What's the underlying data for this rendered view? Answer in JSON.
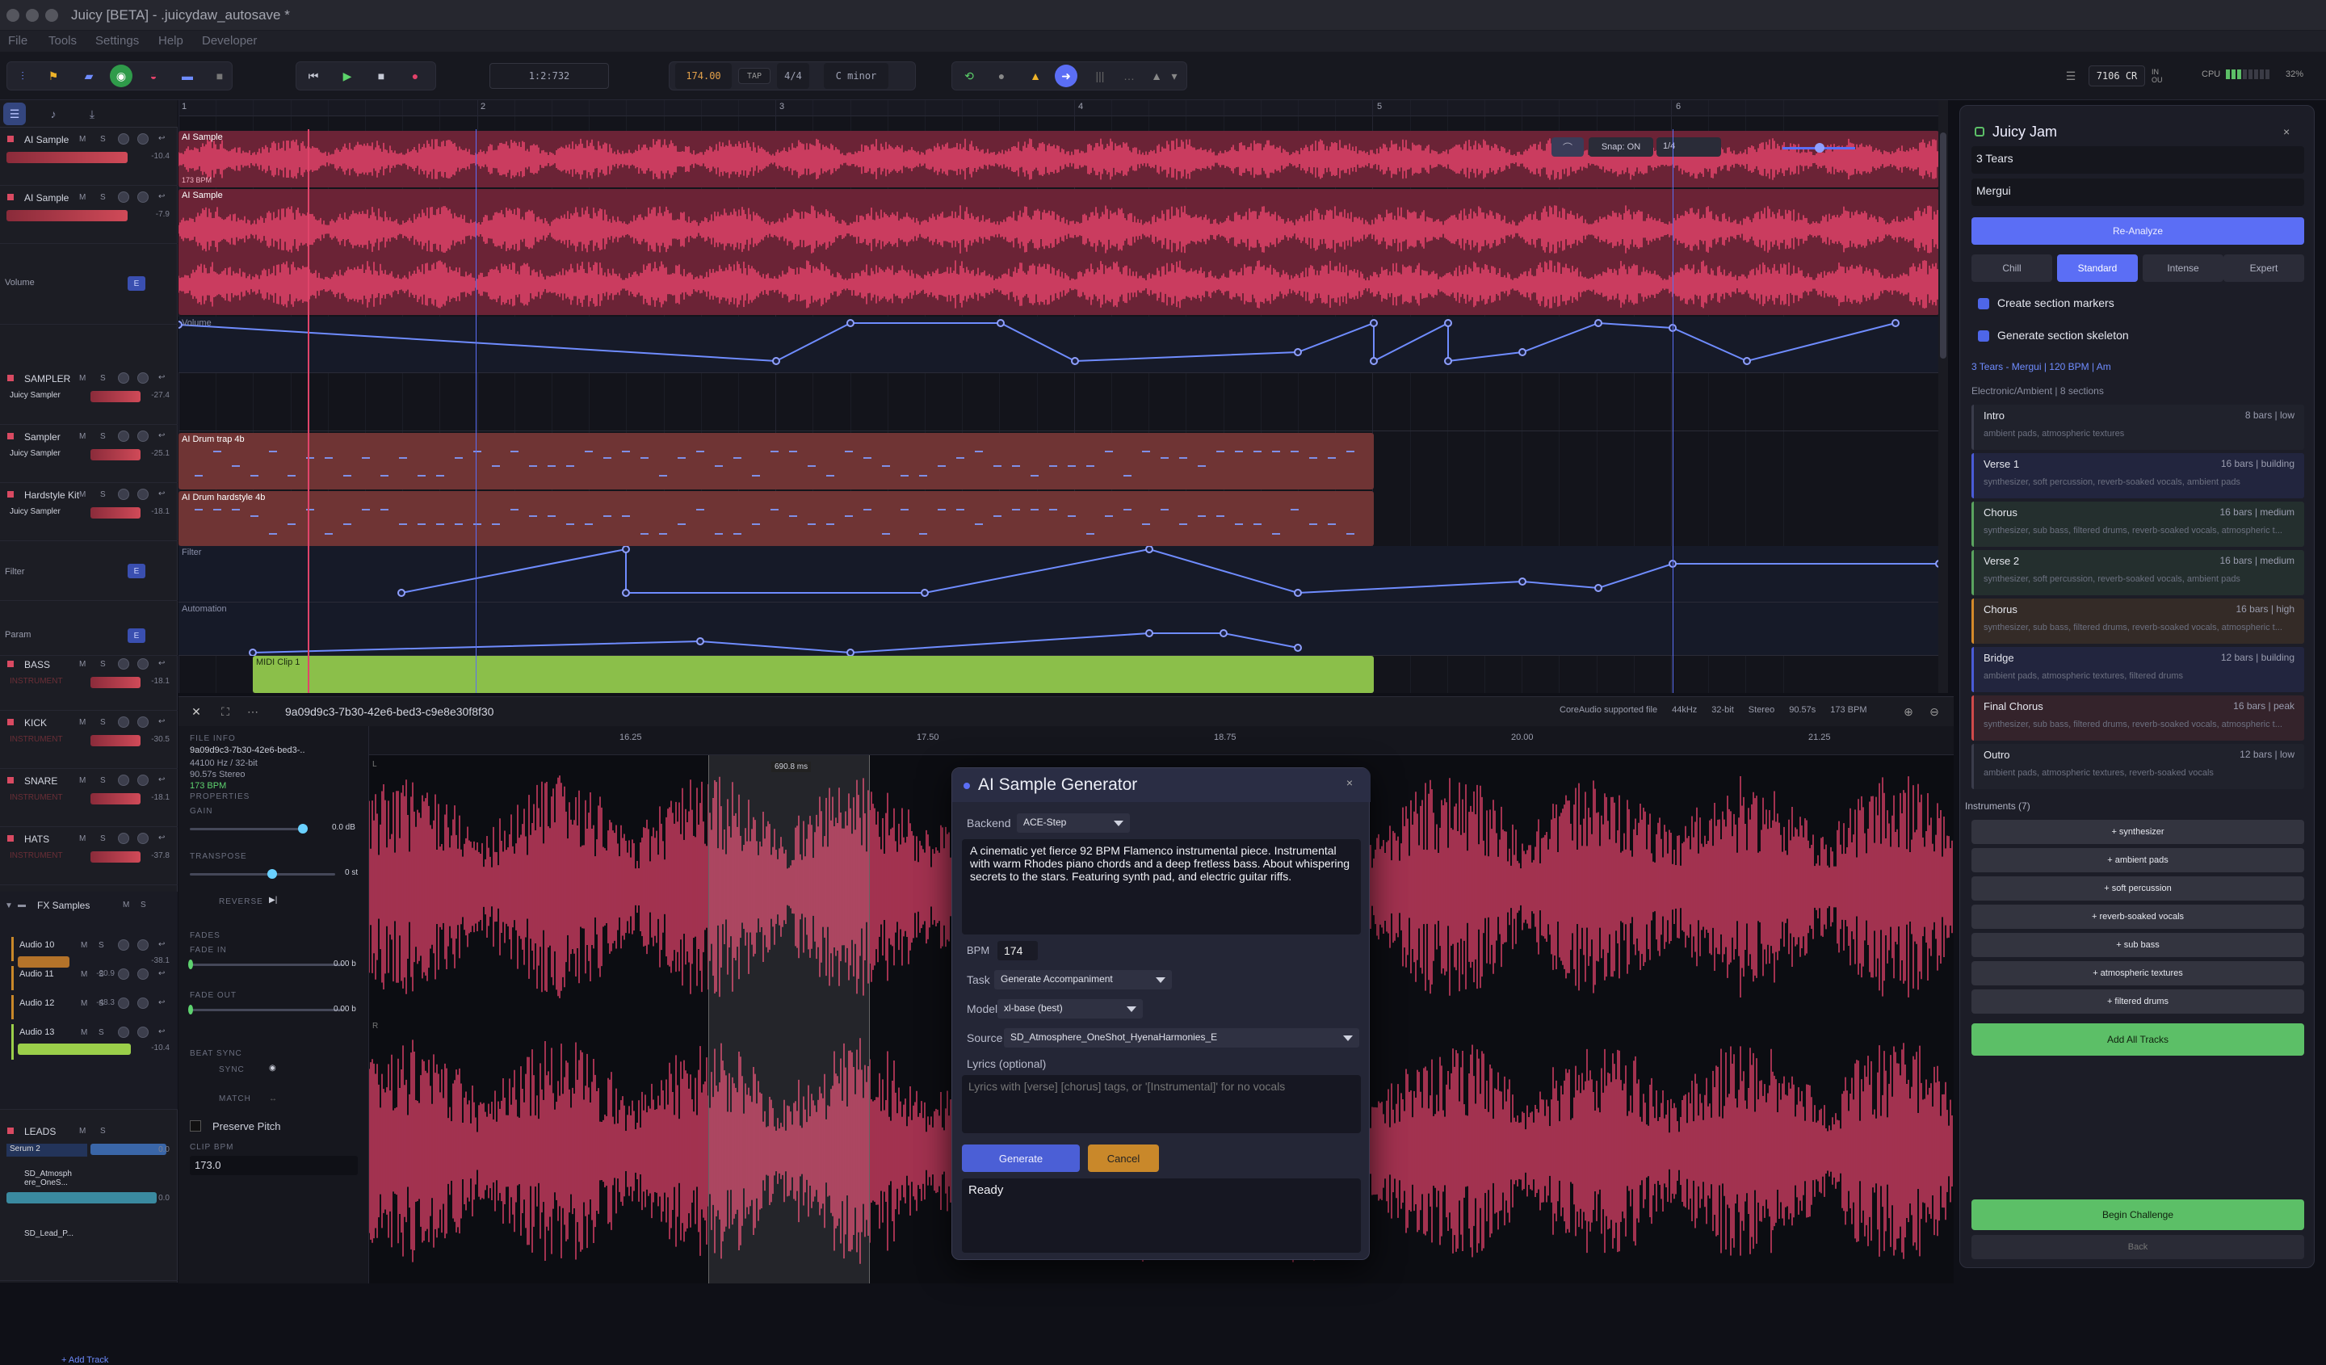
{
  "window": {
    "title": "Juicy [BETA] - .juicydaw_autosave *"
  },
  "menu": [
    "File",
    "Tools",
    "Settings",
    "Help",
    "Developer"
  ],
  "transport": {
    "position": "1:2:732",
    "bpm": "174.00",
    "tap": "TAP",
    "time_sig": "4/4",
    "key": "C minor",
    "credits": "7106 CR",
    "in_label": "IN",
    "ou_label": "OU",
    "cpu_label": "CPU",
    "cpu_percent": "32%"
  },
  "snap": {
    "label": "Snap: ON",
    "grid": "1/4"
  },
  "bars": [
    "1",
    "2",
    "3",
    "4",
    "5",
    "6"
  ],
  "tracks": [
    {
      "name": "AI Sample",
      "db": "-10.4"
    },
    {
      "name": "AI Sample",
      "db": "-7.9"
    },
    {
      "name": "Volume",
      "type": "auto",
      "btn": "E"
    },
    {
      "name": "SAMPLER",
      "sub": "Juicy Sampler",
      "db": "-27.4"
    },
    {
      "name": "Sampler",
      "sub": "Juicy Sampler",
      "db": "-25.1"
    },
    {
      "name": "Hardstyle Kit",
      "sub": "Juicy Sampler",
      "db": "-18.1"
    },
    {
      "name": "Filter",
      "type": "auto",
      "btn": "E"
    },
    {
      "name": "Param",
      "type": "auto",
      "btn": "E"
    },
    {
      "name": "BASS",
      "sub": "INSTRUMENT",
      "db": "-18.1"
    },
    {
      "name": "KICK",
      "sub": "INSTRUMENT",
      "db": "-30.5"
    },
    {
      "name": "SNARE",
      "sub": "INSTRUMENT",
      "db": "-18.1"
    },
    {
      "name": "HATS",
      "sub": "INSTRUMENT",
      "db": "-37.8"
    }
  ],
  "fx_group": {
    "name": "FX Samples",
    "children": [
      {
        "name": "Audio 10",
        "db": "-38.1"
      },
      {
        "name": "Audio 11",
        "db": "-20.9"
      },
      {
        "name": "Audio 12",
        "db": "-48.3"
      },
      {
        "name": "Audio 13",
        "db": "-10.4"
      }
    ]
  },
  "leads": {
    "name": "LEADS",
    "children": [
      {
        "name": "Serum 2",
        "db": "0.0"
      },
      {
        "name": "SD_Atmosph ere_OneS...",
        "db": "0.0"
      },
      {
        "name": "SD_Lead_P..."
      }
    ]
  },
  "add_track": "+ Add Track",
  "clips": {
    "ai1": "AI Sample",
    "ai1_bpm": "173 BPM",
    "ai2": "AI Sample",
    "volume": "Volume",
    "drum_trap": "AI Drum trap 4b",
    "drum_hard": "AI Drum hardstyle 4b",
    "filter": "Filter",
    "automation": "Automation",
    "midi": "MIDI Clip 1"
  },
  "editor": {
    "clip_id": "9a09d9c3-7b30-42e6-bed3-c9e8e30f8f30",
    "info_badges": [
      "CoreAudio supported file",
      "44kHz",
      "32-bit",
      "Stereo",
      "90.57s",
      "173 BPM"
    ],
    "ruler": [
      "16.25",
      "17.50",
      "18.75",
      "20.00",
      "21.25"
    ],
    "selection_len": "690.8 ms",
    "channel_l": "L",
    "channel_r": "R",
    "file_info_label": "FILE INFO",
    "file_name": "9a09d9c3-7b30-42e6-bed3-..",
    "file_rate": "44100 Hz / 32-bit",
    "file_len": "90.57s Stereo",
    "file_bpm": "173 BPM",
    "properties_label": "PROPERTIES",
    "gain_label": "GAIN",
    "gain_value": "0.0 dB",
    "transpose_label": "TRANSPOSE",
    "transpose_value": "0 st",
    "reverse_label": "REVERSE",
    "fades_label": "FADES",
    "fade_in_label": "FADE IN",
    "fade_in_value": "0.00 b",
    "fade_out_label": "FADE OUT",
    "fade_out_value": "0.00 b",
    "beat_sync_label": "BEAT SYNC",
    "sync_label": "SYNC",
    "match_label": "MATCH",
    "preserve_pitch": "Preserve Pitch",
    "clip_bpm_label": "CLIP BPM",
    "clip_bpm_value": "173.0"
  },
  "modal": {
    "title": "AI Sample Generator",
    "backend_label": "Backend",
    "backend_value": "ACE-Step",
    "prompt": "A cinematic yet fierce 92 BPM Flamenco instrumental piece. Instrumental with warm Rhodes piano chords and a deep fretless bass. About whispering secrets to the stars. Featuring synth pad, and electric guitar riffs.",
    "bpm_label": "BPM",
    "bpm_value": "174",
    "task_label": "Task",
    "task_value": "Generate Accompaniment",
    "model_label": "Model",
    "model_value": "xl-base (best)",
    "source_label": "Source",
    "source_value": "SD_Atmosphere_OneShot_HyenaHarmonies_E",
    "lyrics_label": "Lyrics (optional)",
    "lyrics_placeholder": "Lyrics with [verse] [chorus] tags, or '[Instrumental]' for no vocals",
    "generate": "Generate",
    "cancel": "Cancel",
    "status": "Ready"
  },
  "jam": {
    "title": "Juicy Jam",
    "song": "3 Tears",
    "artist": "Mergui",
    "reanalyze": "Re-Analyze",
    "difficulties": [
      "Chill",
      "Standard",
      "Intense",
      "Expert"
    ],
    "difficulty_selected": "Standard",
    "opt1": "Create section markers",
    "opt2": "Generate section skeleton",
    "meta": "3 Tears - Mergui | 120 BPM | Am",
    "genre": "Electronic/Ambient | 8 sections",
    "sections": [
      {
        "name": "Intro",
        "bars": "8 bars  |  low",
        "desc": "ambient pads, atmospheric textures",
        "color": "#3a3c4b"
      },
      {
        "name": "Verse 1",
        "bars": "16 bars  |  building",
        "desc": "synthesizer, soft percussion, reverb-soaked vocals, ambient pads",
        "color": "#4a5bd8"
      },
      {
        "name": "Chorus",
        "bars": "16 bars  |  medium",
        "desc": "synthesizer, sub bass, filtered drums, reverb-soaked vocals, atmospheric t...",
        "color": "#5aa35f"
      },
      {
        "name": "Verse 2",
        "bars": "16 bars  |  medium",
        "desc": "synthesizer, soft percussion, reverb-soaked vocals, ambient pads",
        "color": "#5aa35f"
      },
      {
        "name": "Chorus",
        "bars": "16 bars  |  high",
        "desc": "synthesizer, sub bass, filtered drums, reverb-soaked vocals, atmospheric t...",
        "color": "#d48a2a"
      },
      {
        "name": "Bridge",
        "bars": "12 bars  |  building",
        "desc": "ambient pads, atmospheric textures, filtered drums",
        "color": "#4a5bd8"
      },
      {
        "name": "Final Chorus",
        "bars": "16 bars  |  peak",
        "desc": "synthesizer, sub bass, filtered drums, reverb-soaked vocals, atmospheric t...",
        "color": "#d04a4a"
      },
      {
        "name": "Outro",
        "bars": "12 bars  |  low",
        "desc": "ambient pads, atmospheric textures, reverb-soaked vocals",
        "color": "#3a3c4b"
      }
    ],
    "instruments_label": "Instruments (7)",
    "instruments": [
      "+ synthesizer",
      "+ ambient pads",
      "+ soft percussion",
      "+ reverb-soaked vocals",
      "+ sub bass",
      "+ atmospheric textures",
      "+ filtered drums"
    ],
    "add_all": "Add All Tracks",
    "begin": "Begin Challenge",
    "back": "Back"
  },
  "colors": {
    "accent": "#5b6ef5",
    "clip_red": "#e2426a",
    "green": "#5cbf67",
    "orange": "#c9882a"
  }
}
